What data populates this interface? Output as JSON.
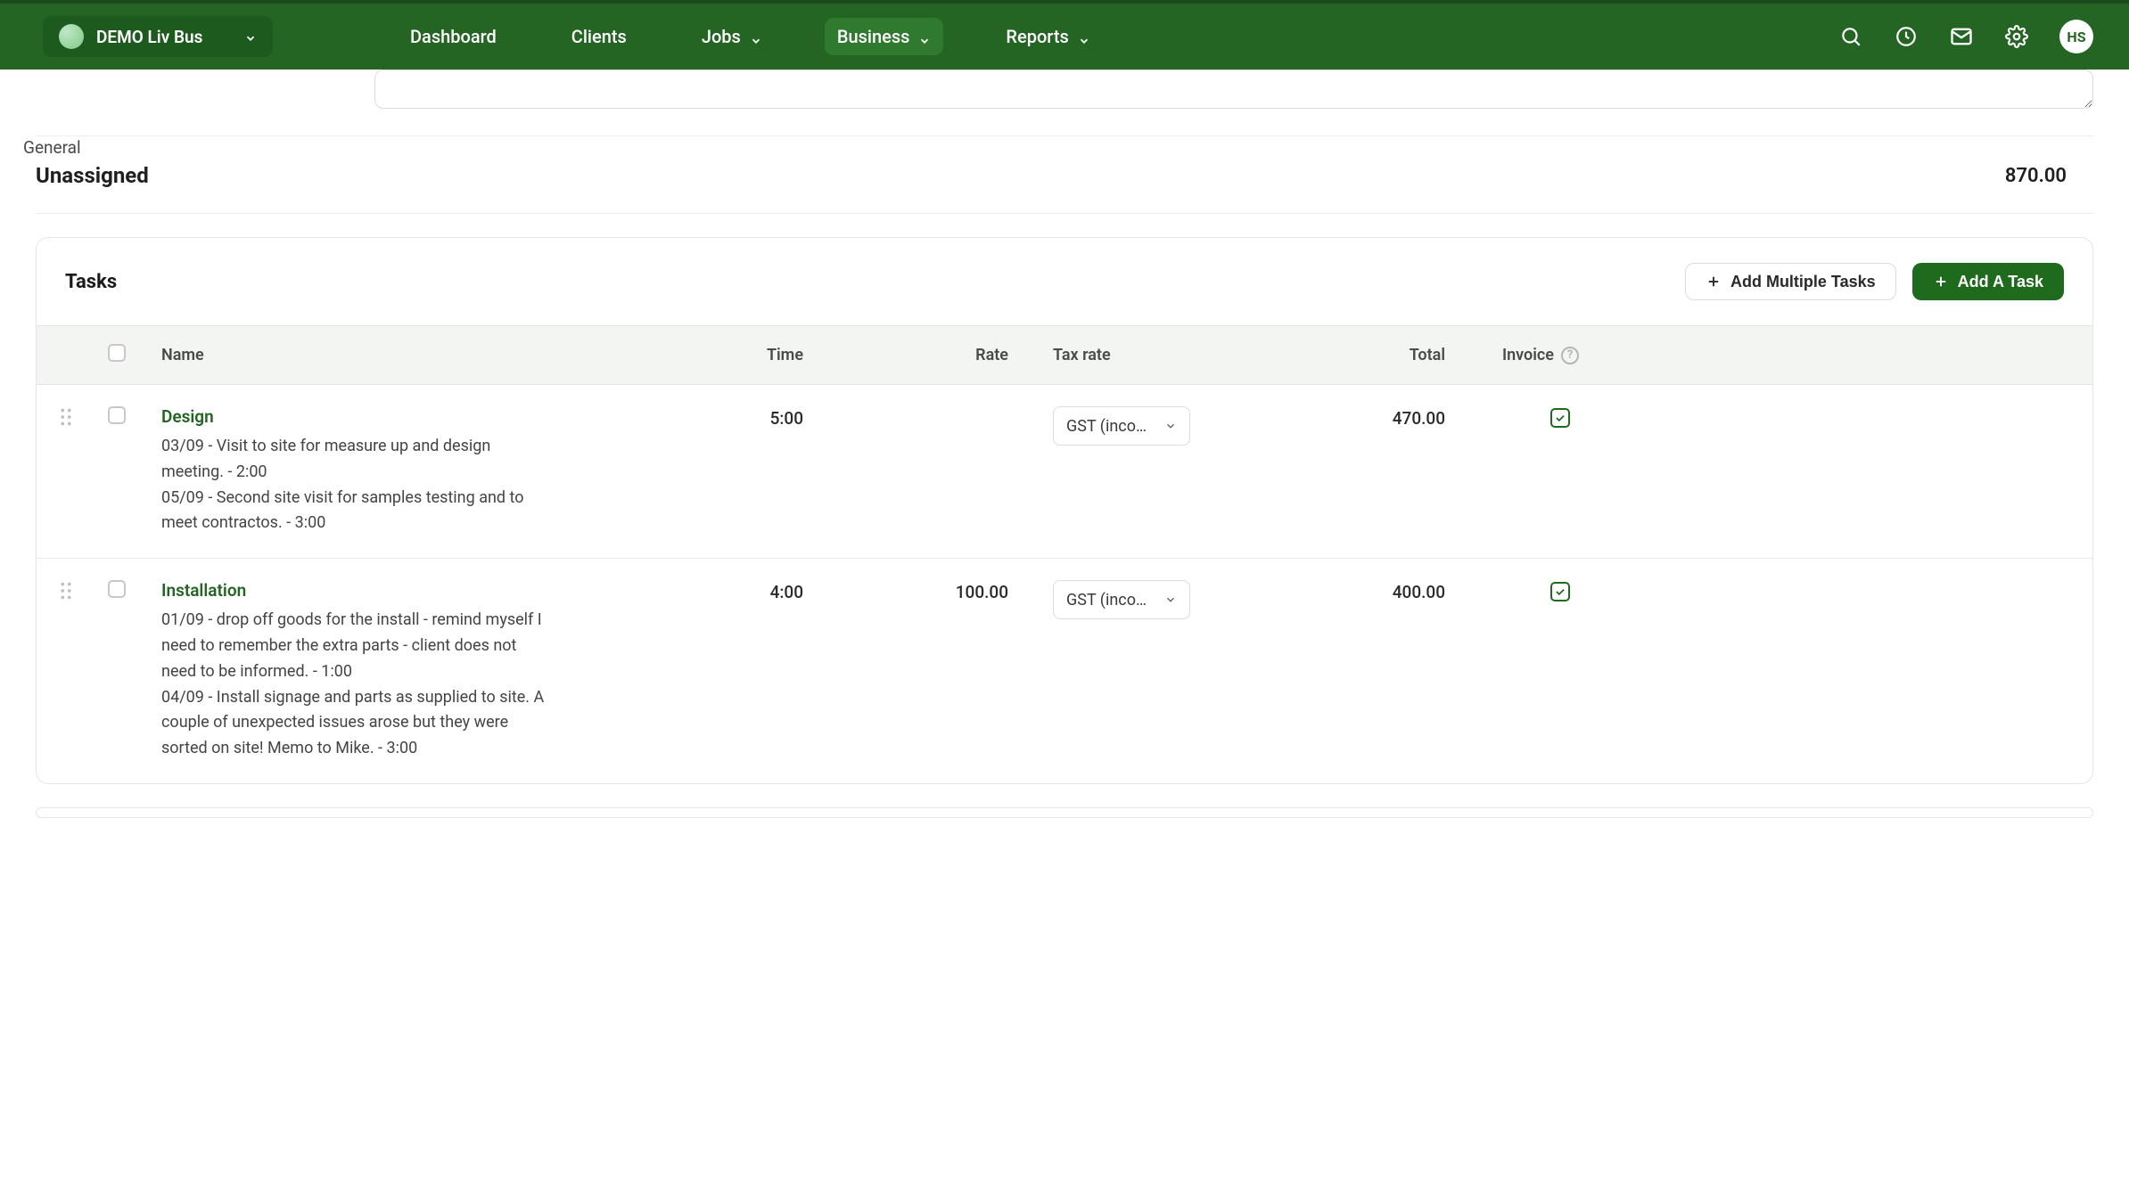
{
  "org": {
    "name": "DEMO Liv Bus"
  },
  "nav": {
    "dashboard": "Dashboard",
    "clients": "Clients",
    "jobs": "Jobs",
    "business": "Business",
    "reports": "Reports"
  },
  "user": {
    "initials": "HS"
  },
  "sidebar": {
    "general": "General"
  },
  "section": {
    "title": "Unassigned",
    "total": "870.00"
  },
  "tasks": {
    "title": "Tasks",
    "actions": {
      "add_multiple": "Add Multiple Tasks",
      "add_task": "Add A Task"
    },
    "columns": {
      "name": "Name",
      "time": "Time",
      "rate": "Rate",
      "tax_rate": "Tax rate",
      "total": "Total",
      "invoice": "Invoice"
    },
    "rows": [
      {
        "name": "Design",
        "description": "03/09 - Visit to site for measure up and design meeting. - 2:00\n05/09 - Second site visit for samples testing and to meet contractos. - 3:00",
        "time": "5:00",
        "rate": "",
        "tax_label": "GST (income…",
        "total": "470.00",
        "invoice": true
      },
      {
        "name": "Installation",
        "description": "01/09 - drop off goods for the install - remind myself I need to remember the extra parts - client does not need to be informed. - 1:00\n04/09 - Install signage and parts as supplied to site.  A couple of unexpected issues arose but they were sorted on site!  Memo to Mike. - 3:00",
        "time": "4:00",
        "rate": "100.00",
        "tax_label": "GST (income…",
        "total": "400.00",
        "invoice": true
      }
    ]
  }
}
